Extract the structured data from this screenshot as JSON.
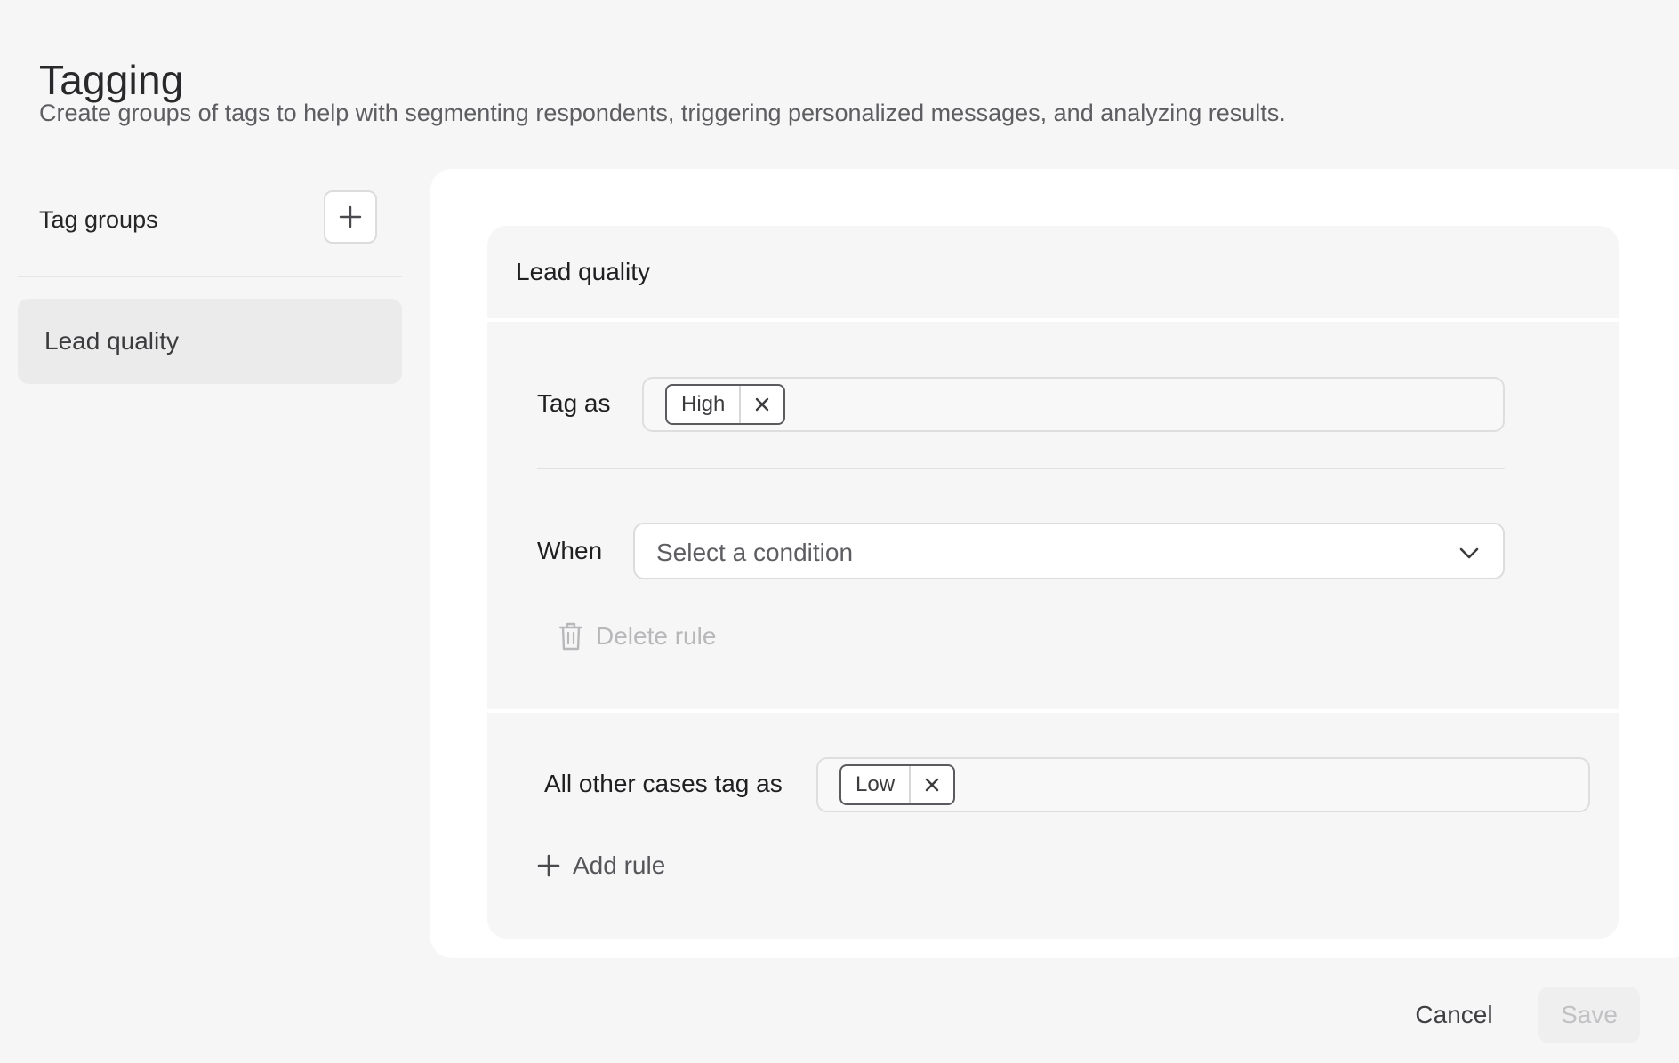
{
  "page": {
    "title": "Tagging",
    "subtitle": "Create groups of tags to help with segmenting respondents, triggering personalized messages, and analyzing results."
  },
  "sidebar": {
    "title": "Tag groups",
    "add_icon": "plus-icon",
    "items": [
      {
        "label": "Lead quality",
        "selected": true
      }
    ]
  },
  "group": {
    "title": "Lead quality",
    "rule": {
      "tag_as_label": "Tag as",
      "tags": [
        {
          "label": "High",
          "remove_icon": "close-icon"
        }
      ],
      "when_label": "When",
      "condition_placeholder": "Select a condition",
      "condition_icon": "chevron-down-icon",
      "delete_label": "Delete rule",
      "delete_icon": "trash-icon"
    },
    "default_rule": {
      "label": "All other cases tag as",
      "tags": [
        {
          "label": "Low",
          "remove_icon": "close-icon"
        }
      ]
    },
    "add_rule_label": "Add rule",
    "add_rule_icon": "plus-icon"
  },
  "footer": {
    "cancel_label": "Cancel",
    "save_label": "Save"
  },
  "colors": {
    "background": "#f6f6f6",
    "panel": "#ffffff",
    "disabled_text": "#b8b8bb",
    "chip_border": "#5b5b5f"
  }
}
